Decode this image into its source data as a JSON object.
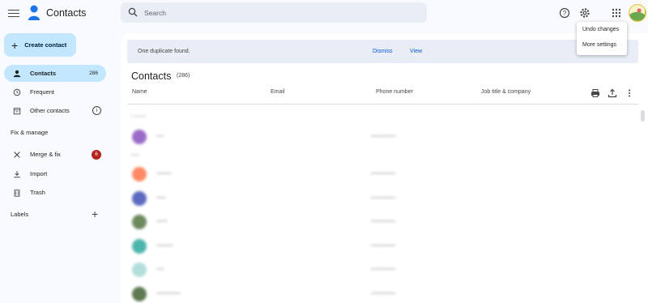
{
  "header": {
    "app_title": "Contacts",
    "search_placeholder": "Search",
    "icons": [
      "menu-icon",
      "contacts-logo-icon",
      "search-icon",
      "help-icon",
      "settings-icon",
      "apps-grid-icon",
      "avatar"
    ]
  },
  "settings_menu": {
    "items": [
      "Undo changes",
      "More settings"
    ]
  },
  "sidebar": {
    "create_label": "Create contact",
    "items": [
      {
        "label": "Contacts",
        "count": "286",
        "icon": "person-icon"
      },
      {
        "label": "Frequent",
        "icon": "history-icon"
      },
      {
        "label": "Other contacts",
        "icon": "archive-icon"
      }
    ],
    "fix_section": "Fix & manage",
    "fix_items": [
      {
        "label": "Merge & fix",
        "badge": "6",
        "icon": "merge-icon"
      },
      {
        "label": "Import",
        "icon": "download-icon"
      },
      {
        "label": "Trash",
        "icon": "trash-icon"
      }
    ],
    "labels_section": "Labels"
  },
  "main": {
    "banner": {
      "message": "One duplicate found.",
      "dismiss": "Dismiss",
      "view": "View"
    },
    "title": "Contacts",
    "count": "(286)",
    "columns": [
      "Name",
      "Email",
      "Phone number",
      "Job title & company"
    ]
  },
  "colors": {
    "accent": "#c2e7ff",
    "link": "#0b57d0",
    "badge": "#b3261e",
    "avatars": [
      "#9c6bc9",
      "#ff8a65",
      "#5c6bc0",
      "#6d8a5e",
      "#4db6ac",
      "#b2dfdb",
      "#5d7a52"
    ]
  }
}
